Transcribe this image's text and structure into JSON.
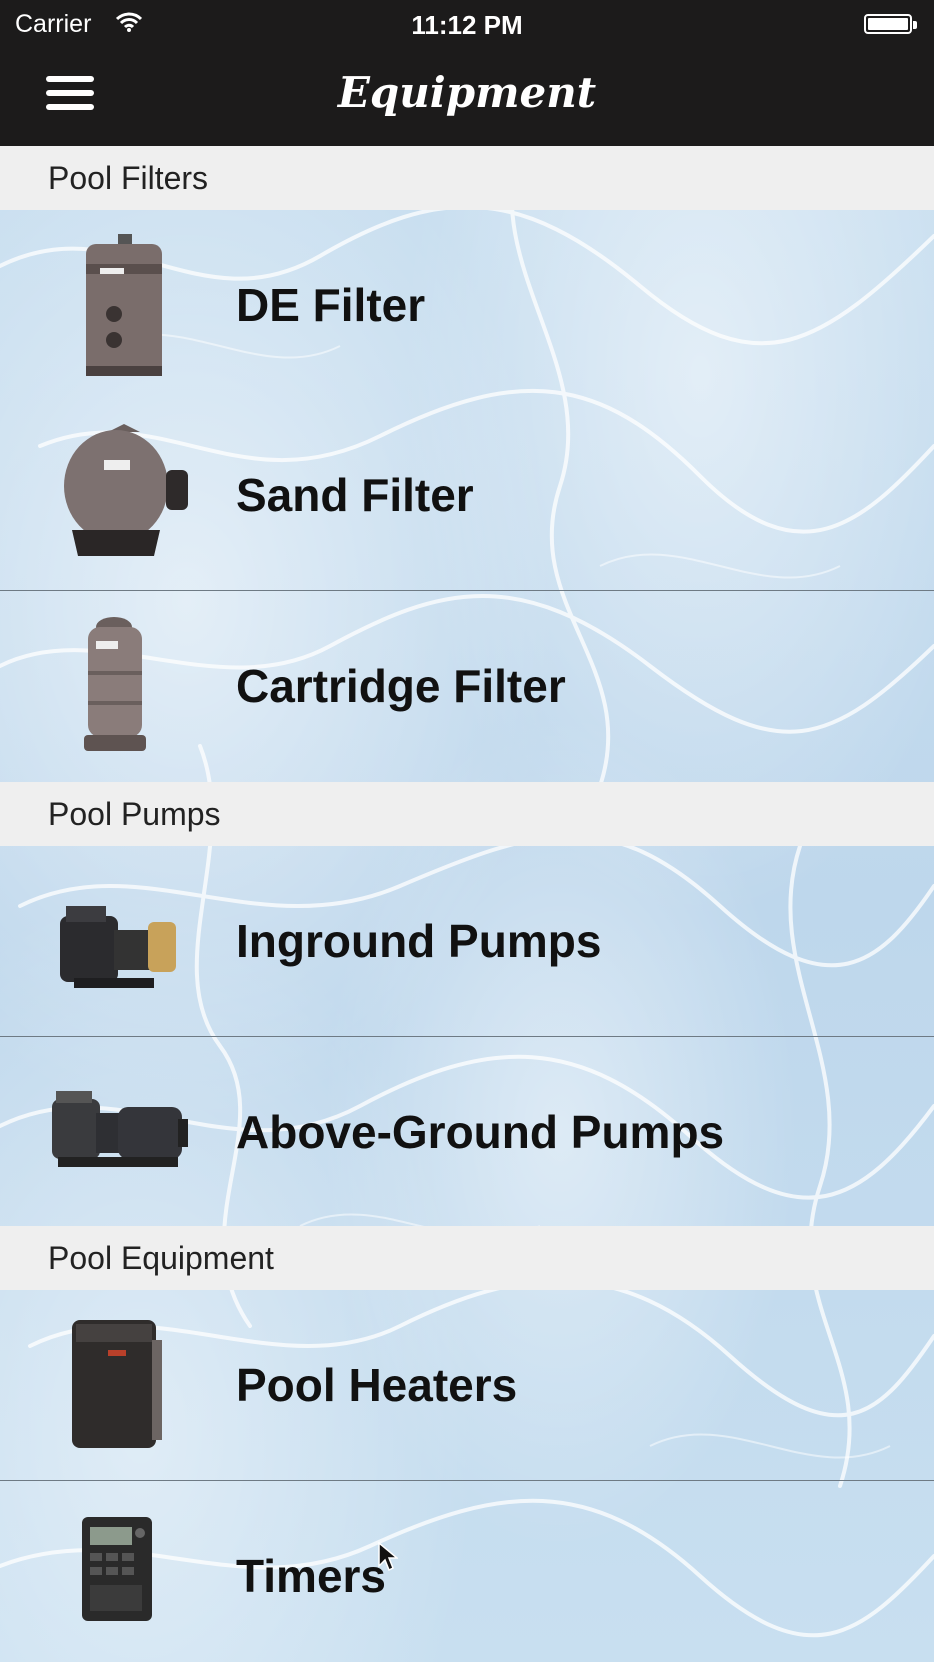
{
  "status_bar": {
    "carrier": "Carrier",
    "time": "11:12 PM"
  },
  "nav": {
    "title": "Equipment",
    "menu_icon": "hamburger-menu-icon"
  },
  "sections": [
    {
      "header": "Pool Filters",
      "items": [
        {
          "label": "DE Filter",
          "icon": "de-filter-image"
        },
        {
          "label": "Sand Filter",
          "icon": "sand-filter-image"
        },
        {
          "label": "Cartridge Filter",
          "icon": "cartridge-filter-image"
        }
      ]
    },
    {
      "header": "Pool Pumps",
      "items": [
        {
          "label": "Inground Pumps",
          "icon": "inground-pump-image"
        },
        {
          "label": "Above-Ground Pumps",
          "icon": "above-ground-pump-image"
        }
      ]
    },
    {
      "header": "Pool Equipment",
      "items": [
        {
          "label": "Pool Heaters",
          "icon": "pool-heater-image"
        },
        {
          "label": "Timers",
          "icon": "timer-image"
        }
      ]
    }
  ],
  "colors": {
    "nav_bg": "#1c1b1b",
    "section_bg": "#efefef",
    "water": "#c9dff0"
  }
}
